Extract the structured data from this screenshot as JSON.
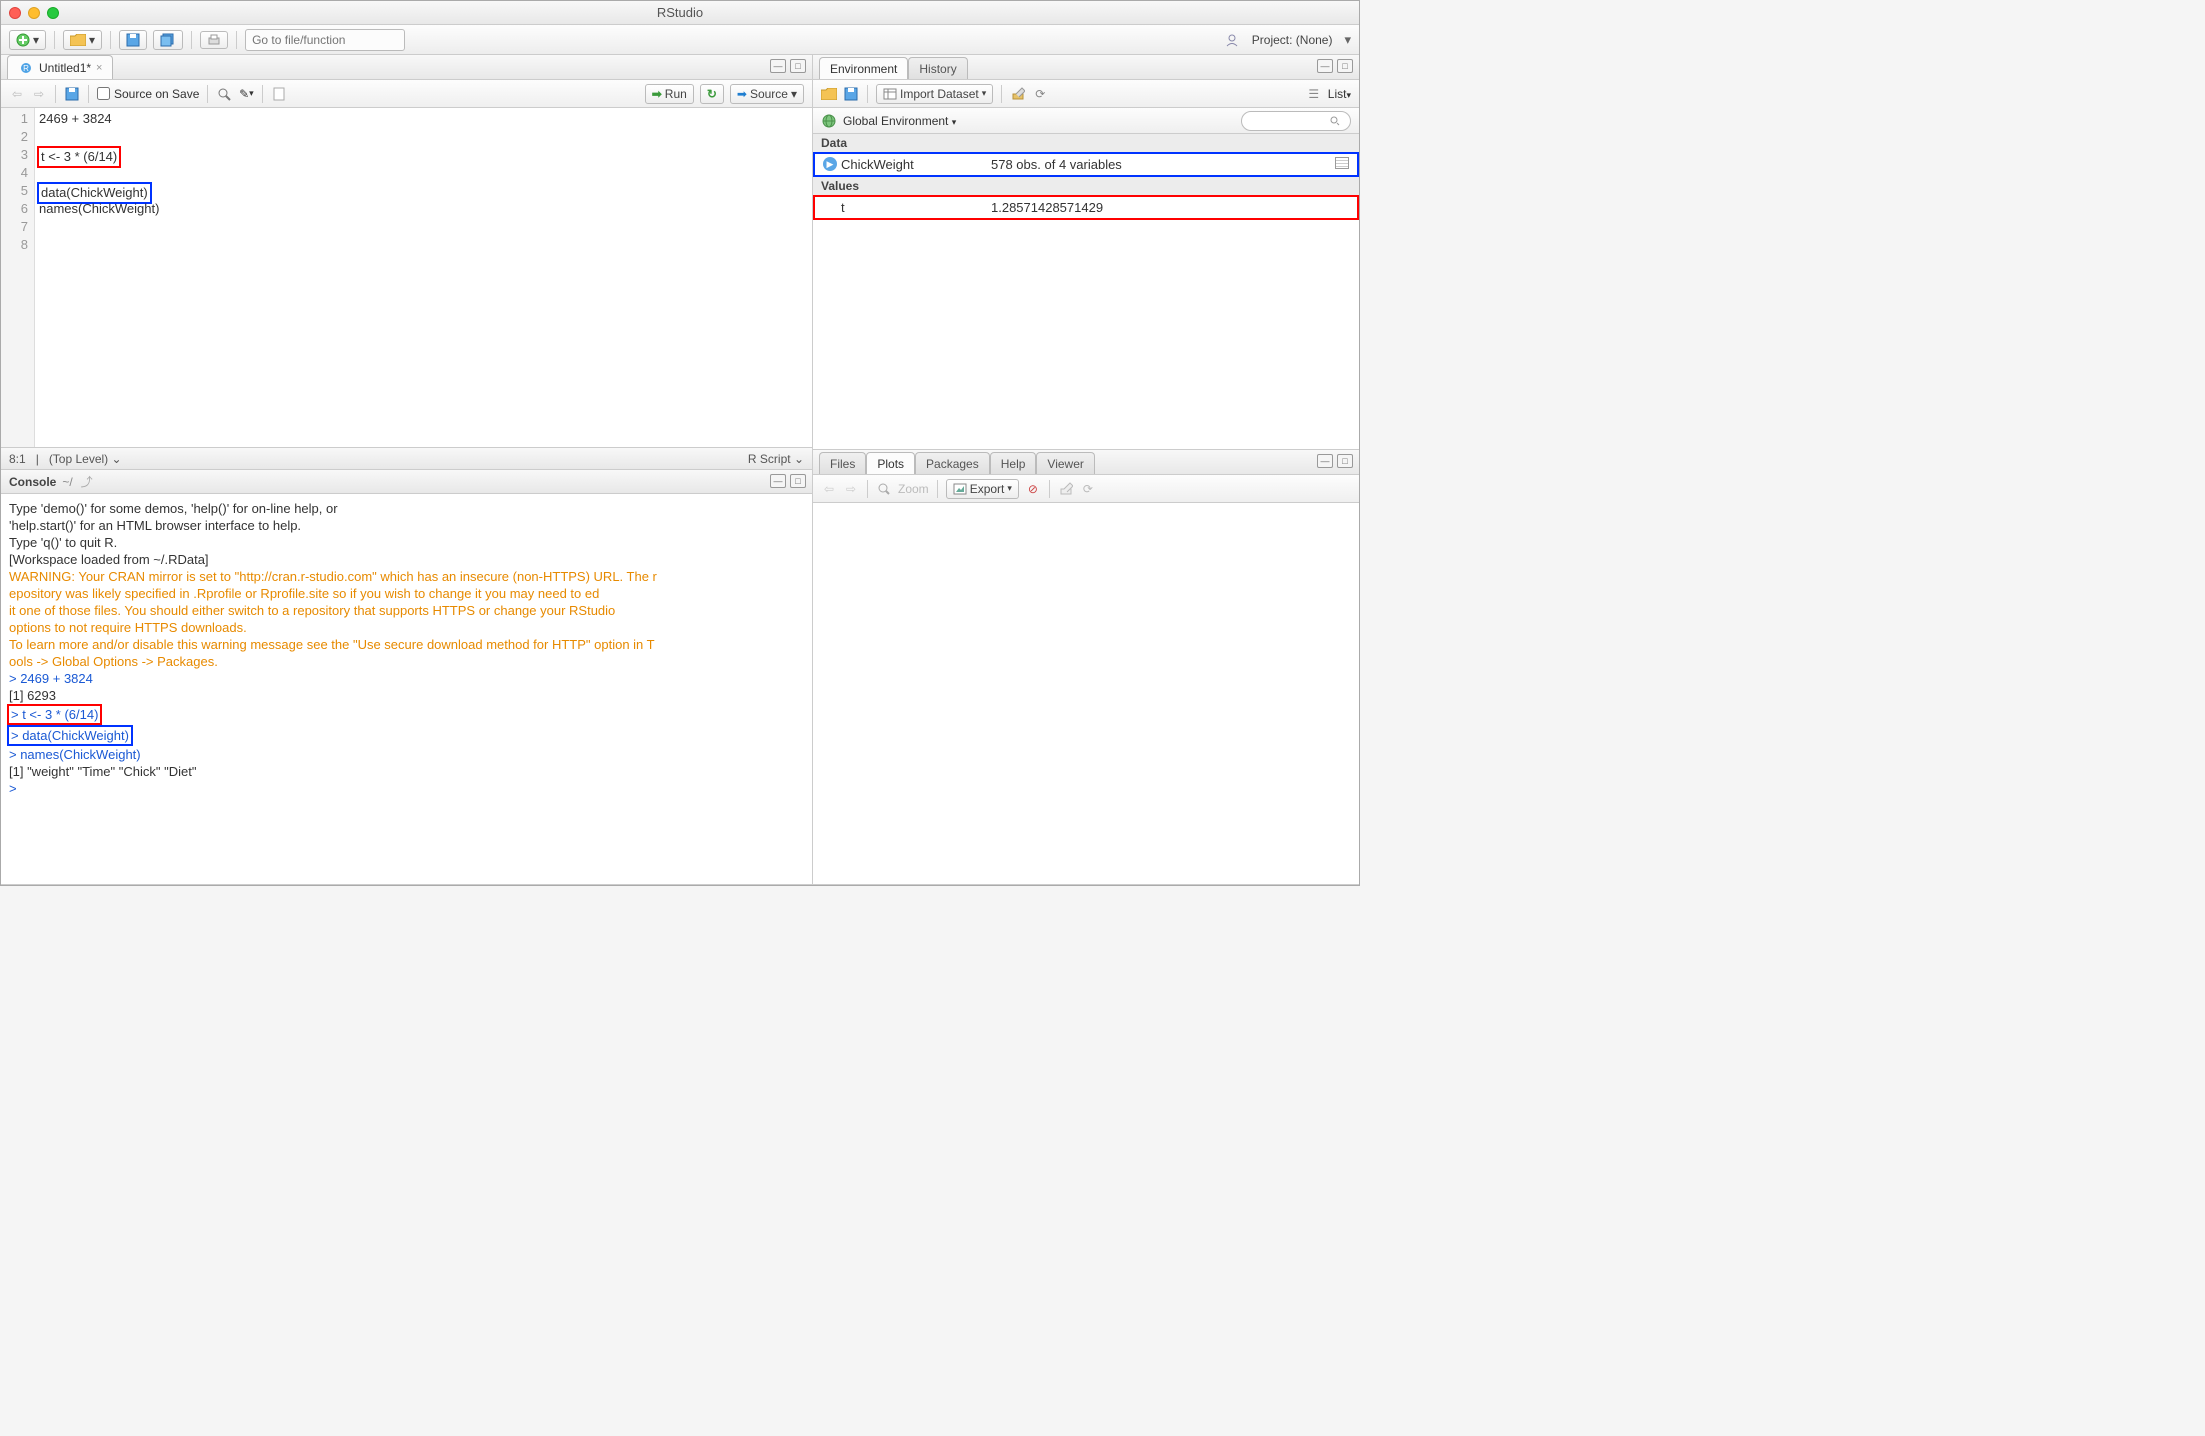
{
  "window": {
    "title": "RStudio"
  },
  "main_toolbar": {
    "goto_placeholder": "Go to file/function",
    "project_label": "Project: (None)"
  },
  "source": {
    "tab_title": "Untitled1*",
    "source_on_save_label": "Source on Save",
    "run_label": "Run",
    "source_label": "Source",
    "lines": {
      "l1": "2469 + 3824",
      "l2": "",
      "l3": "t <- 3 * (6/14)",
      "l4": "",
      "l5": "data(ChickWeight)",
      "l6": "names(ChickWeight)",
      "l7": "",
      "l8": ""
    },
    "line_numbers": {
      "n1": "1",
      "n2": "2",
      "n3": "3",
      "n4": "4",
      "n5": "5",
      "n6": "6",
      "n7": "7",
      "n8": "8"
    },
    "cursor": "8:1",
    "scope": "(Top Level)",
    "lang": "R Script"
  },
  "console": {
    "title": "Console",
    "path": "~/",
    "body": {
      "l1": "Type 'demo()' for some demos, 'help()' for on-line help, or",
      "l2": "'help.start()' for an HTML browser interface to help.",
      "l3": "Type 'q()' to quit R.",
      "l4": "",
      "l5": "[Workspace loaded from ~/.RData]",
      "l6": "",
      "w1": "WARNING: Your CRAN mirror is set to \"http://cran.r-studio.com\" which has an insecure (non-HTTPS) URL. The r",
      "w2": "epository was likely specified in .Rprofile or Rprofile.site so if you wish to change it you may need to ed",
      "w3": "it one of those files. You should either switch to a repository that supports HTTPS or change your RStudio ",
      "w4": "options to not require HTTPS downloads.",
      "w5": "",
      "w6": "To learn more and/or disable this warning message see the \"Use secure download method for HTTP\" option in T",
      "w7": "ools -> Global Options -> Packages.",
      "c1": "> 2469 + 3824",
      "r1": "[1] 6293",
      "c2": "> t <- 3 * (6/14)",
      "c3": "> data(ChickWeight)",
      "c4": "> names(ChickWeight)",
      "r2": "[1] \"weight\" \"Time\"   \"Chick\"  \"Diet\"  ",
      "prompt": "> "
    }
  },
  "env": {
    "tabs": {
      "env": "Environment",
      "hist": "History"
    },
    "import_label": "Import Dataset",
    "scope_label": "Global Environment",
    "list_label": "List",
    "section_data": "Data",
    "section_values": "Values",
    "data": {
      "name": "ChickWeight",
      "desc": "578 obs. of 4 variables"
    },
    "value": {
      "name": "t",
      "val": "1.28571428571429"
    }
  },
  "files": {
    "tabs": {
      "files": "Files",
      "plots": "Plots",
      "packages": "Packages",
      "help": "Help",
      "viewer": "Viewer"
    },
    "zoom_label": "Zoom",
    "export_label": "Export"
  }
}
